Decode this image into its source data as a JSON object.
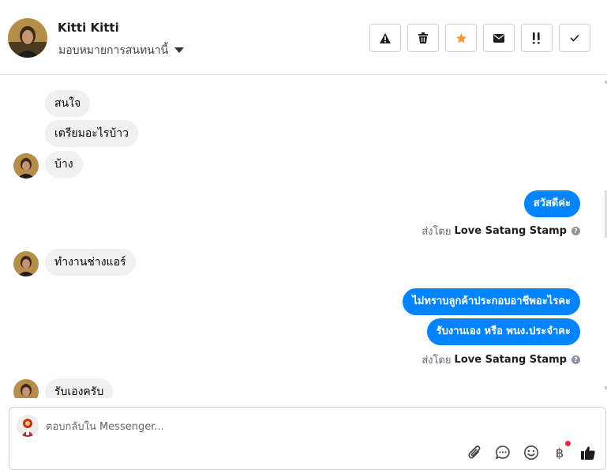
{
  "header": {
    "contact_name": "Kitti Kitti",
    "assign_label": "มอบหมายการสนทนานี้",
    "actions": [
      {
        "icon": "warning-icon"
      },
      {
        "icon": "trash-icon"
      },
      {
        "icon": "star-icon",
        "color": "#f5963f"
      },
      {
        "icon": "envelope-icon"
      },
      {
        "icon": "exclamation-icon"
      },
      {
        "icon": "check-icon"
      }
    ]
  },
  "thread": {
    "messages": [
      {
        "dir": "in",
        "text": "สนใจ"
      },
      {
        "dir": "in",
        "text": "เตรียมอะไรบ้าว"
      },
      {
        "dir": "in",
        "text": "บ้าง"
      },
      {
        "dir": "out",
        "text": "สวัสดีค่ะ"
      },
      {
        "dir": "in",
        "text": "ทำงานช่างแอร์"
      },
      {
        "dir": "out",
        "text": "ไม่ทราบลูกค้าประกอบอาชีพอะไรคะ"
      },
      {
        "dir": "out",
        "text": "รับงานเอง หรือ พนง.ประจำคะ"
      },
      {
        "dir": "in",
        "text": "รับเองครับ"
      }
    ],
    "sent_by_prefix": "ส่งโดย",
    "sent_by_name": "Love Satang Stamp"
  },
  "composer": {
    "placeholder": "ตอบกลับใน Messenger...",
    "value": "",
    "tools": [
      "paperclip-icon",
      "chat-bubble-icon",
      "smiley-icon",
      "baht-icon",
      "thumbs-up-icon"
    ],
    "baht_symbol": "฿"
  },
  "colors": {
    "outgoing_bubble": "#0084ff",
    "incoming_bubble": "#f0f0f0",
    "notification_dot": "#f02849"
  }
}
